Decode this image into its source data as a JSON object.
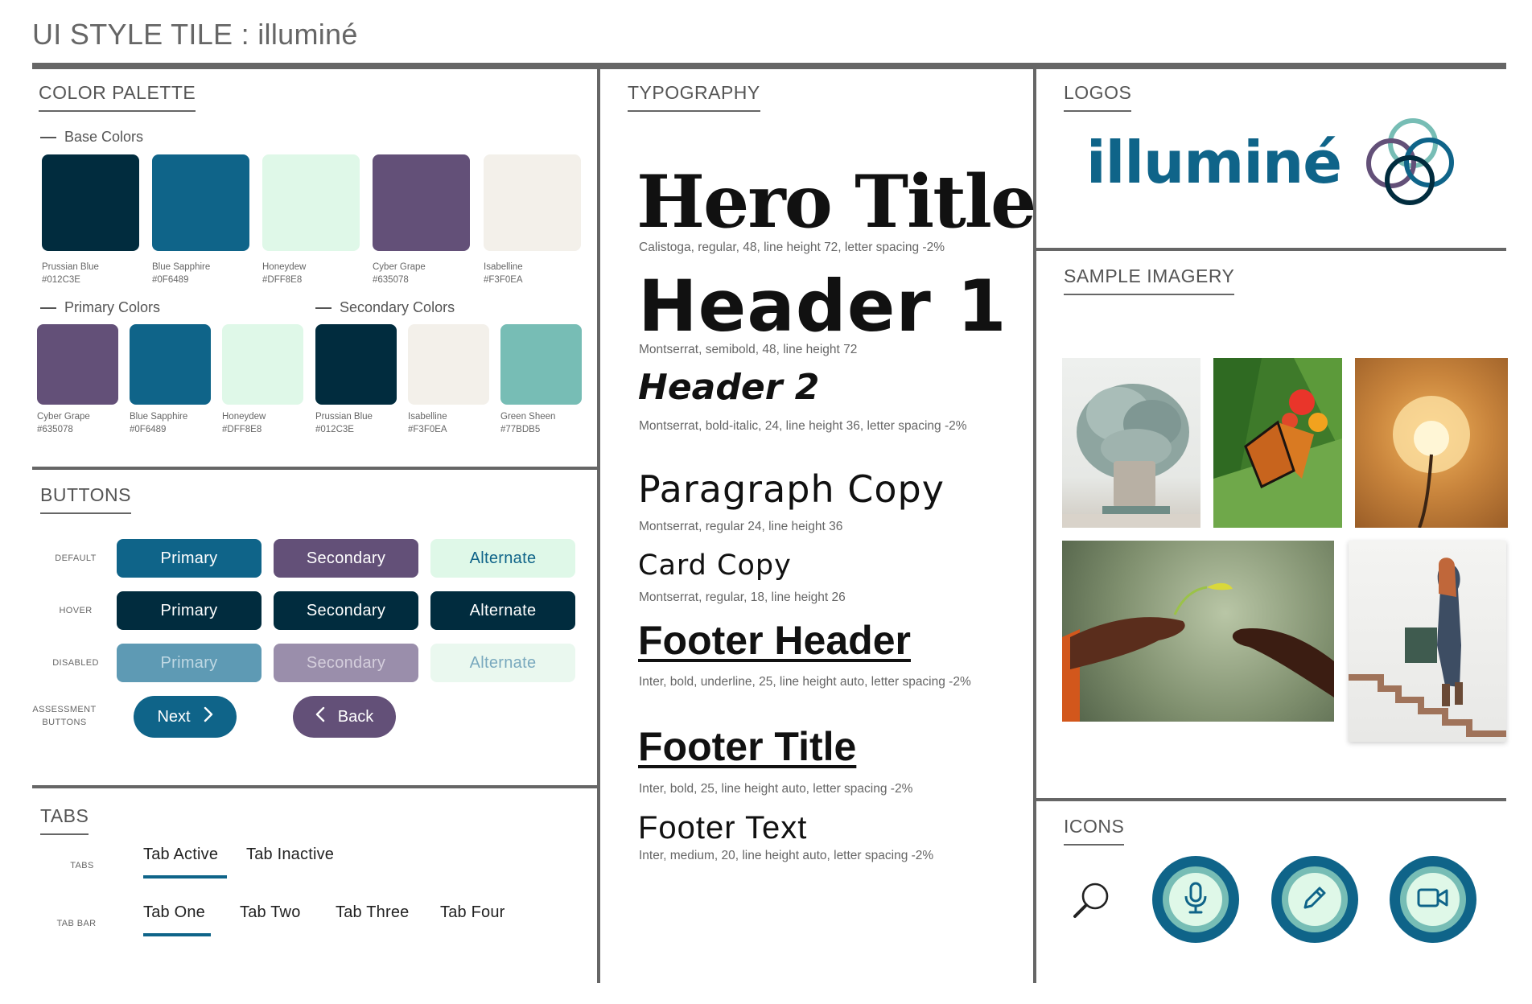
{
  "page_title": "UI STYLE TILE : illuminé",
  "sections": {
    "color_palette": "COLOR PALETTE",
    "buttons": "BUTTONS",
    "tabs": "TABS",
    "typography": "TYPOGRAPHY",
    "logos": "LOGOS",
    "sample_imagery": "SAMPLE IMAGERY",
    "icons": "ICONS"
  },
  "palette": {
    "base_heading": "Base Colors",
    "primary_heading": "Primary Colors",
    "secondary_heading": "Secondary Colors",
    "base": [
      {
        "name": "Prussian Blue",
        "hex": "#012C3E"
      },
      {
        "name": "Blue Sapphire",
        "hex": "#0F6489"
      },
      {
        "name": "Honeydew",
        "hex": "#DFF8E8"
      },
      {
        "name": "Cyber Grape",
        "hex": "#635078"
      },
      {
        "name": "Isabelline",
        "hex": "#F3F0EA"
      }
    ],
    "primary": [
      {
        "name": "Cyber Grape",
        "hex": "#635078"
      },
      {
        "name": "Blue Sapphire",
        "hex": "#0F6489"
      },
      {
        "name": "Honeydew",
        "hex": "#DFF8E8"
      }
    ],
    "secondary": [
      {
        "name": "Prussian Blue",
        "hex": "#012C3E"
      },
      {
        "name": "Isabelline",
        "hex": "#F3F0EA"
      },
      {
        "name": "Green Sheen",
        "hex": "#77BDB5"
      }
    ]
  },
  "buttons": {
    "states": [
      "DEFAULT",
      "HOVER",
      "DISABLED",
      "ASSESSMENT BUTTONS"
    ],
    "labels": [
      "Primary",
      "Secondary",
      "Alternate"
    ],
    "next": "Next",
    "back": "Back"
  },
  "tabs": {
    "row_labels": [
      "TABS",
      "TAB BAR"
    ],
    "tab_active": "Tab Active",
    "tab_inactive": "Tab Inactive",
    "tab_bar": [
      "Tab One",
      "Tab Two",
      "Tab Three",
      "Tab Four"
    ]
  },
  "typography": [
    {
      "sample": "Hero Title",
      "desc": "Calistoga, regular, 48, line height 72, letter spacing -2%"
    },
    {
      "sample": "Header 1",
      "desc": "Montserrat, semibold, 48, line height 72"
    },
    {
      "sample": "Header 2",
      "desc": "Montserrat, bold-italic, 24, line height 36, letter spacing -2%"
    },
    {
      "sample": "Paragraph Copy",
      "desc": "Montserrat,  regular 24, line height 36"
    },
    {
      "sample": "Card Copy",
      "desc": "Montserrat,  regular, 18, line height 26"
    },
    {
      "sample": "Footer Header",
      "desc": "Inter, bold, underline, 25, line height auto, letter spacing -2%"
    },
    {
      "sample": "Footer Title",
      "desc": "Inter, bold, 25, line height auto, letter spacing -2%"
    },
    {
      "sample": "Footer Text",
      "desc": "Inter, medium, 20, line height auto, letter spacing -2%"
    }
  ],
  "logo": {
    "wordmark": "illuminé"
  },
  "icons": [
    "search-icon",
    "microphone-icon",
    "pencil-icon",
    "video-camera-icon"
  ]
}
